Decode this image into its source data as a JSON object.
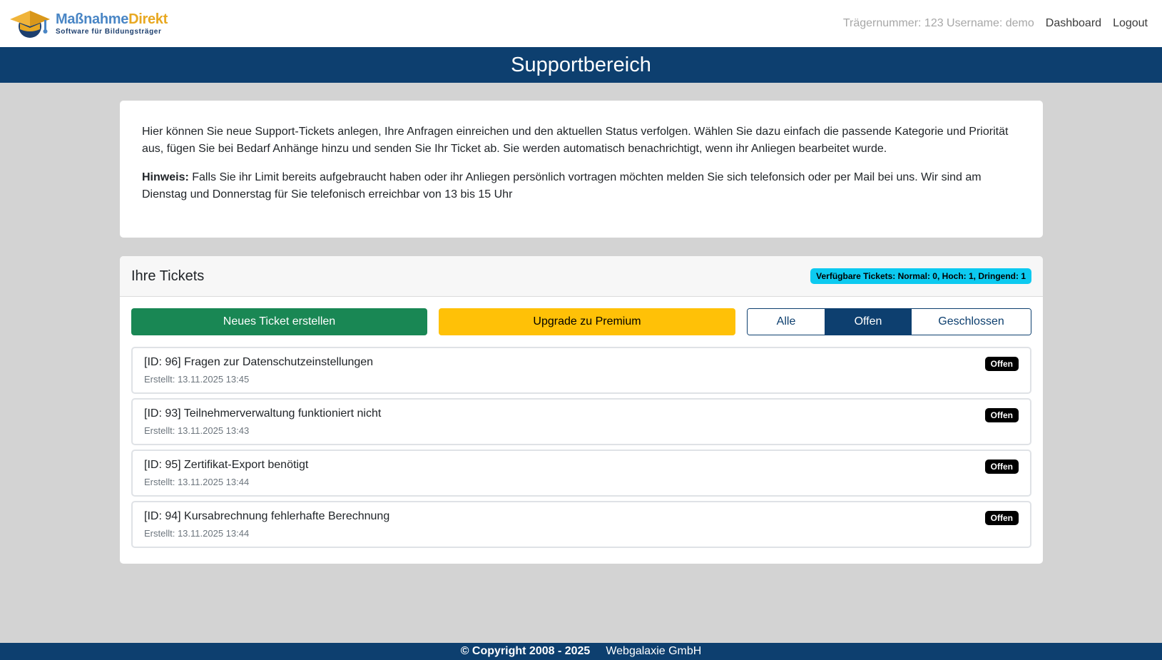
{
  "brand": {
    "name_part1": "Maßnahme",
    "name_part2": "Direkt",
    "tagline": "Software für Bildungsträger",
    "icon": "graduation-cap-logo"
  },
  "nav": {
    "info": "Trägernummer: 123 Username: demo",
    "dashboard": "Dashboard",
    "logout": "Logout"
  },
  "page_title": "Supportbereich",
  "intro": {
    "text": "Hier können Sie neue Support-Tickets anlegen, Ihre Anfragen einreichen und den aktuellen Status verfolgen. Wählen Sie dazu einfach die passende Kategorie und Priorität aus, fügen Sie bei Bedarf Anhänge hinzu und senden Sie Ihr Ticket ab. Sie werden automatisch benachrichtigt, wenn ihr Anliegen bearbeitet wurde.",
    "hint_label": "Hinweis:",
    "hint_text": " Falls Sie ihr Limit bereits aufgebraucht haben oder ihr Anliegen persönlich vortragen möchten melden Sie sich telefonsich oder per Mail bei uns. Wir sind am Dienstag und Donnerstag für Sie telefonisch erreichbar von 13 bis 15 Uhr"
  },
  "tickets": {
    "title": "Ihre Tickets",
    "quota": "Verfügbare Tickets: Normal: 0, Hoch: 1, Dringend: 1",
    "new_button": "Neues Ticket erstellen",
    "upgrade_button": "Upgrade zu Premium",
    "filters": {
      "all": "Alle",
      "open": "Offen",
      "closed": "Geschlossen",
      "active": "open"
    },
    "items": [
      {
        "title": "[ID: 96] Fragen zur Datenschutzeinstellungen",
        "created": "Erstellt: 13.11.2025 13:45",
        "status": "Offen"
      },
      {
        "title": "[ID: 93] Teilnehmerverwaltung funktioniert nicht",
        "created": "Erstellt: 13.11.2025 13:43",
        "status": "Offen"
      },
      {
        "title": "[ID: 95] Zertifikat-Export benötigt",
        "created": "Erstellt: 13.11.2025 13:44",
        "status": "Offen"
      },
      {
        "title": "[ID: 94] Kursabrechnung fehlerhafte Berechnung",
        "created": "Erstellt: 13.11.2025 13:44",
        "status": "Offen"
      }
    ]
  },
  "footer": {
    "copyright": "© Copyright 2008 - 2025",
    "company": "Webgalaxie GmbH"
  },
  "colors": {
    "primary": "#0d3f6f",
    "success": "#198754",
    "warning": "#ffc107",
    "info": "#0dcaf0",
    "background": "#d3d3d3"
  }
}
